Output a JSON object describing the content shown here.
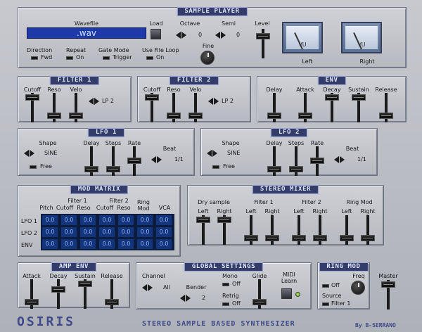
{
  "sample_player": {
    "title": "SAMPLE PLAYER",
    "wavefile_label": "Wavefile",
    "wavefile_value": ".wav",
    "load_label": "Load",
    "octave_label": "Octave",
    "octave_value": "0",
    "semi_label": "Semi",
    "semi_value": "0",
    "fine_label": "Fine",
    "level_label": "Level",
    "direction_label": "Direction",
    "direction_value": "Fwd",
    "repeat_label": "Repeat",
    "repeat_value": "On",
    "gate_mode_label": "Gate Mode",
    "gate_mode_value": "Trigger",
    "use_file_loop_label": "Use File Loop",
    "use_file_loop_value": "On",
    "vu_text": "VU",
    "vu_left_label": "Left",
    "vu_right_label": "Right"
  },
  "filter1": {
    "title": "FILTER 1",
    "cutoff": "Cutoff",
    "reso": "Reso",
    "velo": "Velo",
    "mode": "LP 2"
  },
  "filter2": {
    "title": "FILTER 2",
    "cutoff": "Cutoff",
    "reso": "Reso",
    "velo": "Velo",
    "mode": "LP 2"
  },
  "env": {
    "title": "ENV",
    "delay": "Delay",
    "attack": "Attack",
    "decay": "Decay",
    "sustain": "Sustain",
    "release": "Release"
  },
  "lfo1": {
    "title": "LFO 1",
    "shape_label": "Shape",
    "shape_value": "SINE",
    "free_label": "Free",
    "delay": "Delay",
    "steps": "Steps",
    "rate": "Rate",
    "beat_label": "Beat",
    "beat_value": "1/1"
  },
  "lfo2": {
    "title": "LFO 2",
    "shape_label": "Shape",
    "shape_value": "SINE",
    "free_label": "Free",
    "delay": "Delay",
    "steps": "Steps",
    "rate": "Rate",
    "beat_label": "Beat",
    "beat_value": "1/1"
  },
  "mod_matrix": {
    "title": "MOD MATRIX",
    "group_filter1": "Filter 1",
    "group_filter2": "Filter 2",
    "cols": [
      "Pitch",
      "Cutoff",
      "Reso",
      "Cutoff",
      "Reso",
      "Ring\nMod",
      "VCA"
    ],
    "rows": [
      {
        "label": "LFO 1",
        "cells": [
          "0.0",
          "0.0",
          "0.0",
          "0.0",
          "0.0",
          "0.0",
          "0.0"
        ]
      },
      {
        "label": "LFO 2",
        "cells": [
          "0.0",
          "0.0",
          "0.0",
          "0.0",
          "0.0",
          "0.0",
          "0.0"
        ]
      },
      {
        "label": "ENV",
        "cells": [
          "0.0",
          "0.0",
          "0.0",
          "0.0",
          "0.0",
          "0.0",
          "0.0"
        ]
      }
    ]
  },
  "stereo_mixer": {
    "title": "STEREO MIXER",
    "dry": "Dry sample",
    "filter1": "Filter 1",
    "filter2": "Filter 2",
    "ringmod": "Ring Mod",
    "left": "Left",
    "right": "Right"
  },
  "amp_env": {
    "title": "AMP ENV",
    "attack": "Attack",
    "decay": "Decay",
    "sustain": "Sustain",
    "release": "Release"
  },
  "global_settings": {
    "title": "GLOBAL SETTINGS",
    "channel_label": "Channel",
    "channel_value": "All",
    "bender_label": "Bender",
    "bender_value": "2",
    "mono_label": "Mono",
    "mono_value": "Off",
    "retrig_label": "Retrig",
    "retrig_value": "Off",
    "glide_label": "Glide",
    "midi_learn_label": "MIDI\nLearn"
  },
  "ring_mod": {
    "title": "RING MOD",
    "state_value": "Off",
    "freq_label": "Freq",
    "source_label": "Source",
    "source_value": "Filter 1"
  },
  "master": {
    "label": "Master"
  },
  "footer": {
    "logo": "OSIRIS",
    "tagline": "STEREO SAMPLE BASED SYNTHESIZER",
    "credit": "By B-SERRANO"
  }
}
